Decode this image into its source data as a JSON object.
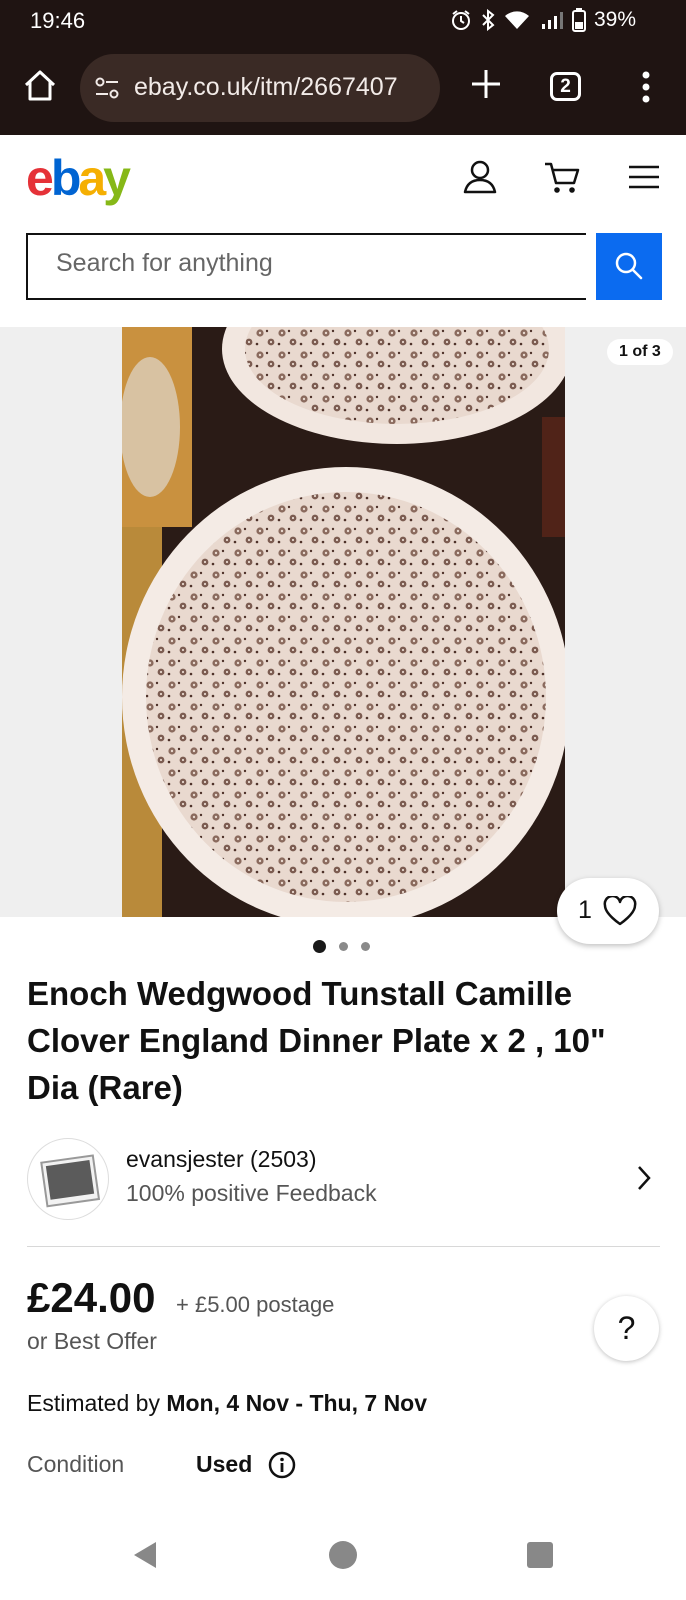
{
  "status_bar": {
    "time": "19:46",
    "battery": "39%"
  },
  "browser": {
    "url": "ebay.co.uk/itm/2667407",
    "tab_count": "2"
  },
  "ebay": {
    "logo": {
      "e": "e",
      "b": "b",
      "a": "a",
      "y": "y"
    },
    "search_placeholder": "Search for anything"
  },
  "gallery": {
    "counter": "1 of 3",
    "watch_count": "1",
    "dots_total": 3,
    "dots_active": 1
  },
  "item": {
    "title": "Enoch Wedgwood Tunstall Camille Clover England Dinner Plate x 2 , 10\" Dia (Rare)"
  },
  "seller": {
    "name": "evansjester (2503)",
    "feedback": "100% positive Feedback"
  },
  "pricing": {
    "price": "£24.00",
    "postage": "+ £5.00 postage",
    "best_offer": "or Best Offer",
    "help": "?"
  },
  "delivery": {
    "prefix": "Estimated by ",
    "dates": "Mon, 4 Nov - Thu, 7 Nov"
  },
  "condition": {
    "label": "Condition",
    "value": "Used"
  },
  "colors": {
    "chrome": "#1f1412",
    "search_button": "#0b6bf0",
    "ebay_red": "#e53238",
    "ebay_blue": "#0064d2",
    "ebay_yellow": "#f5af02",
    "ebay_green": "#86b817"
  }
}
